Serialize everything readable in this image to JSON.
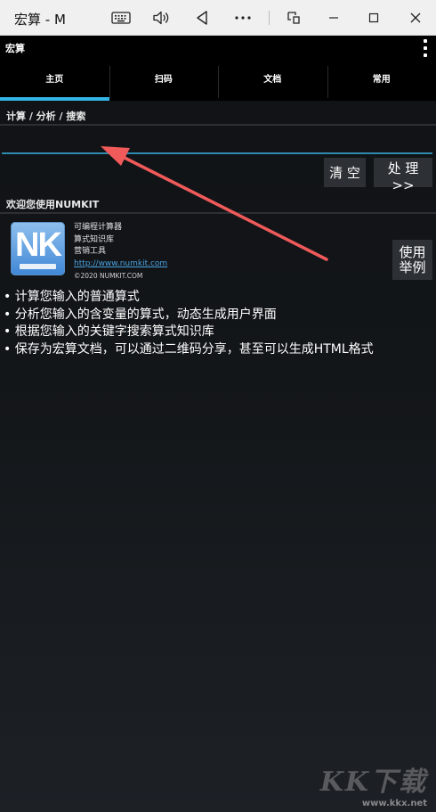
{
  "window": {
    "title": "宏算 - M"
  },
  "actionbar": {
    "title": "宏算"
  },
  "tabs": [
    {
      "label": "主页",
      "active": true
    },
    {
      "label": "扫码"
    },
    {
      "label": "文档"
    },
    {
      "label": "常用"
    }
  ],
  "calc": {
    "section_label": "计算 / 分析 / 搜索",
    "input_value": "",
    "clear_label": "清 空",
    "process_label": "处 理 >>"
  },
  "welcome": {
    "section_label": "欢迎您使用NUMKIT",
    "logo_text": "NK",
    "info_lines": [
      "可编程计算器",
      "算式知识库",
      "营销工具"
    ],
    "link": "http://www.numkit.com",
    "copyright": "©2020 NUMKIT.COM",
    "example_label_line1": "使用",
    "example_label_line2": "举例"
  },
  "features": [
    "• 计算您输入的普通算式",
    "• 分析您输入的含变量的算式，动态生成用户界面",
    "• 根据您输入的关键字搜索算式知识库",
    "• 保存为宏算文档，可以通过二维码分享，甚至可以生成HTML格式"
  ],
  "watermark": {
    "logo": "KK下载",
    "url": "www.kkx.net"
  },
  "colors": {
    "accent": "#33b5e5",
    "annotation_arrow": "#f05a5a"
  }
}
